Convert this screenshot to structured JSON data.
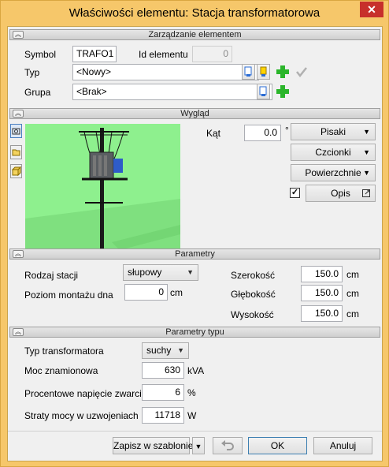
{
  "window": {
    "title": "Właściwości elementu: Stacja transformatorowa",
    "close": "✕"
  },
  "section_management": {
    "title": "Zarządzanie elementem"
  },
  "symbol": {
    "label": "Symbol",
    "value": "TRAFO1"
  },
  "element_id": {
    "label": "Id elementu",
    "value": "0"
  },
  "type": {
    "label": "Typ",
    "value": "<Nowy>"
  },
  "group": {
    "label": "Grupa",
    "value": "<Brak>"
  },
  "section_appearance": {
    "title": "Wygląd"
  },
  "angle": {
    "label": "Kąt",
    "value": "0.0",
    "unit": "°"
  },
  "buttons_right": {
    "pens": "Pisaki",
    "fonts": "Czcionki",
    "surfaces": "Powierzchnie",
    "description": "Opis"
  },
  "description_checked": true,
  "section_params": {
    "title": "Parametry"
  },
  "station_type": {
    "label": "Rodzaj stacji",
    "value": "słupowy"
  },
  "mount_level": {
    "label": "Poziom montażu dna",
    "value": "0",
    "unit": "cm"
  },
  "width": {
    "label": "Szerokość",
    "value": "150.0",
    "unit": "cm"
  },
  "depth": {
    "label": "Głębokość",
    "value": "150.0",
    "unit": "cm"
  },
  "height": {
    "label": "Wysokość",
    "value": "150.0",
    "unit": "cm"
  },
  "section_type_params": {
    "title": "Parametry typu"
  },
  "transformer_type": {
    "label": "Typ transformatora",
    "value": "suchy"
  },
  "rated_power": {
    "label": "Moc znamionowa",
    "value": "630",
    "unit": "kVA"
  },
  "short_circuit_voltage": {
    "label": "Procentowe napięcie zwarcia",
    "value": "6",
    "unit": "%"
  },
  "power_loss": {
    "label": "Straty mocy w uzwojeniach",
    "value": "11718",
    "unit": "W"
  },
  "footer": {
    "save_template": "Zapisz w szablonie",
    "ok": "OK",
    "cancel": "Anuluj"
  },
  "colors": {
    "titlebar": "#f6c76a",
    "close": "#c7302b",
    "preview_bg": "#8ef08e",
    "plus": "#2bb52b"
  }
}
